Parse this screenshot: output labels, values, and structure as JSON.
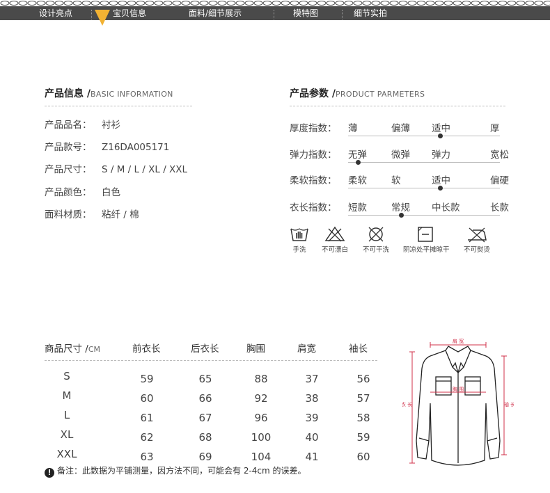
{
  "nav": {
    "items": [
      "设计亮点",
      "宝贝信息",
      "面料/细节展示",
      "模特图",
      "细节实拍"
    ],
    "active_index": 1,
    "accent_color": "#f2b233"
  },
  "basic_info": {
    "title": "产品信息 /",
    "title_en": "BASIC INFORMATION",
    "rows": [
      {
        "label": "产品品名：",
        "value": "衬衫"
      },
      {
        "label": "产品款号：",
        "value": "Z16DA005171"
      },
      {
        "label": "产品尺寸：",
        "value": "S / M / L / XL / XXL"
      },
      {
        "label": "产品颜色：",
        "value": "白色"
      },
      {
        "label": "面料材质：",
        "value": "粘纤 / 棉"
      }
    ]
  },
  "params": {
    "title": "产品参数 /",
    "title_en": "PRODUCT PARMETERS",
    "rows": [
      {
        "label": "厚度指数：",
        "options": [
          "薄",
          "偏薄",
          "适中",
          "厚"
        ],
        "selected_index": 2
      },
      {
        "label": "弹力指数：",
        "options": [
          "无弹",
          "微弹",
          "弹力",
          "宽松"
        ],
        "selected_index": 0
      },
      {
        "label": "柔软指数：",
        "options": [
          "柔软",
          "软",
          "适中",
          "偏硬"
        ],
        "selected_index": 2
      },
      {
        "label": "衣长指数：",
        "options": [
          "短款",
          "常规",
          "中长款",
          "长款"
        ],
        "selected_index": 1
      }
    ]
  },
  "care": [
    {
      "icon": "hand-wash-icon",
      "label": "手洗"
    },
    {
      "icon": "no-bleach-icon",
      "label": "不可漂白"
    },
    {
      "icon": "no-dry-clean-icon",
      "label": "不可干洗"
    },
    {
      "icon": "shade-flat-dry-icon",
      "label": "阴凉处平摊晾干"
    },
    {
      "icon": "no-iron-icon",
      "label": "不可熨烫"
    }
  ],
  "size_table": {
    "header_label": "商品尺寸 /",
    "header_unit": "CM",
    "columns": [
      "前衣长",
      "后衣长",
      "胸围",
      "肩宽",
      "袖长"
    ],
    "rows": [
      {
        "size": "S",
        "values": [
          "59",
          "65",
          "88",
          "37",
          "56"
        ]
      },
      {
        "size": "M",
        "values": [
          "60",
          "66",
          "92",
          "38",
          "57"
        ]
      },
      {
        "size": "L",
        "values": [
          "61",
          "67",
          "96",
          "39",
          "58"
        ]
      },
      {
        "size": "XL",
        "values": [
          "62",
          "68",
          "100",
          "40",
          "59"
        ]
      },
      {
        "size": "XXL",
        "values": [
          "63",
          "69",
          "104",
          "41",
          "60"
        ]
      }
    ],
    "note": "备注：此数据为平铺测量，因方法不同，可能会有 2-4cm 的误差。"
  },
  "diagram": {
    "labels": {
      "shoulder": "肩 宽",
      "chest": "胸 围",
      "length": "衣 长",
      "sleeve": "袖 长"
    },
    "measure_color": "#d0304a"
  }
}
